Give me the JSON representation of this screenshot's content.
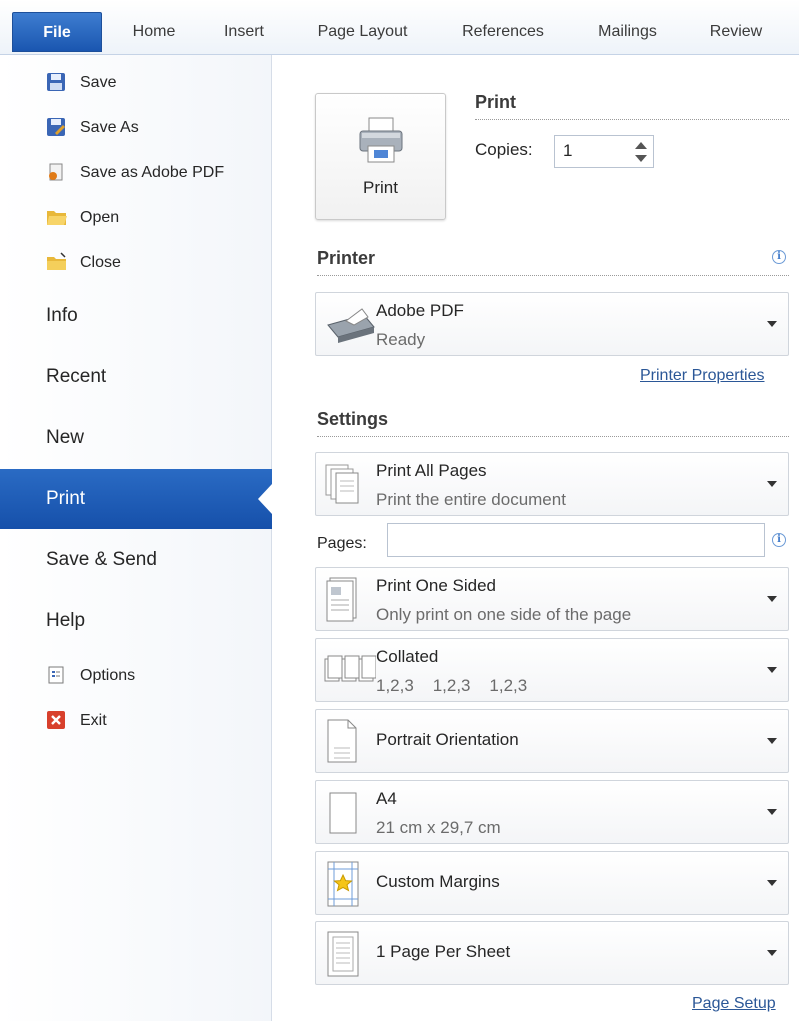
{
  "ribbon": {
    "tabs": [
      "File",
      "Home",
      "Insert",
      "Page Layout",
      "References",
      "Mailings",
      "Review"
    ]
  },
  "nav": {
    "save": "Save",
    "save_as": "Save As",
    "save_adobe": "Save as Adobe PDF",
    "open": "Open",
    "close": "Close",
    "info": "Info",
    "recent": "Recent",
    "new": "New",
    "print": "Print",
    "save_send": "Save & Send",
    "help": "Help",
    "options": "Options",
    "exit": "Exit"
  },
  "print_section": {
    "heading": "Print",
    "button_label": "Print",
    "copies_label": "Copies:",
    "copies_value": "1"
  },
  "printer": {
    "heading": "Printer",
    "name": "Adobe PDF",
    "status": "Ready",
    "properties_link": "Printer Properties"
  },
  "settings": {
    "heading": "Settings",
    "pages_label": "Pages:",
    "pages_value": "",
    "items": [
      {
        "title": "Print All Pages",
        "subtitle": "Print the entire document"
      },
      {
        "title": "Print One Sided",
        "subtitle": "Only print on one side of the page"
      },
      {
        "title": "Collated",
        "subtitle": "1,2,3    1,2,3    1,2,3"
      },
      {
        "title": "Portrait Orientation",
        "subtitle": ""
      },
      {
        "title": "A4",
        "subtitle": "21 cm x 29,7 cm"
      },
      {
        "title": "Custom Margins",
        "subtitle": ""
      },
      {
        "title": "1 Page Per Sheet",
        "subtitle": ""
      }
    ],
    "page_setup_link": "Page Setup"
  },
  "colors": {
    "accent": "#1f5fbf",
    "link": "#2b5797"
  }
}
